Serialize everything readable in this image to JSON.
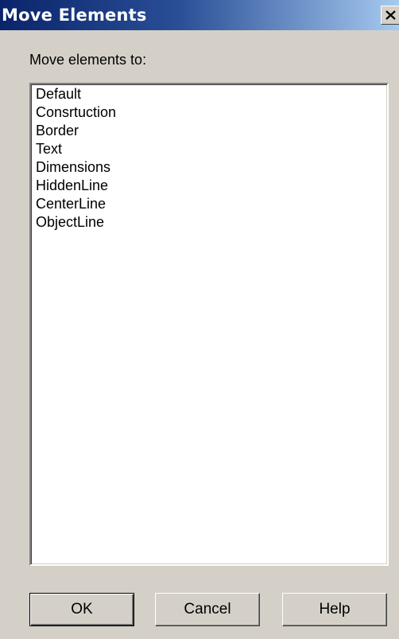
{
  "window": {
    "title": "Move Elements",
    "close_glyph": "close-icon"
  },
  "label": "Move elements to:",
  "list": {
    "items": [
      "Default",
      "Consrtuction",
      "Border",
      "Text",
      "Dimensions",
      "HiddenLine",
      "CenterLine",
      "ObjectLine"
    ]
  },
  "buttons": {
    "ok": "OK",
    "cancel": "Cancel",
    "help": "Help"
  },
  "colors": {
    "titlebar_start": "#0a246a",
    "titlebar_end": "#a6caf0",
    "face": "#d4d0c8"
  }
}
